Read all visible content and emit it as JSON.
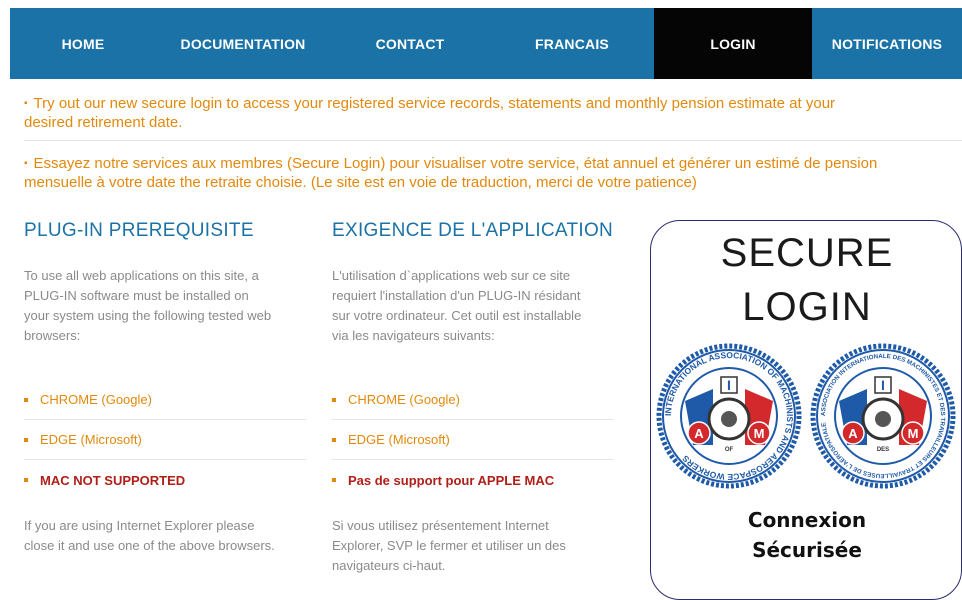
{
  "nav": {
    "items": [
      {
        "label": "HOME",
        "active": false
      },
      {
        "label": "DOCUMENTATION",
        "active": false
      },
      {
        "label": "CONTACT",
        "active": false
      },
      {
        "label": "FRANCAIS",
        "active": false
      },
      {
        "label": "LOGIN",
        "active": true
      },
      {
        "label": "NOTIFICATIONS",
        "active": false
      }
    ]
  },
  "notices": {
    "english_line1": "Try out our new secure login to access your registered service records, statements and monthly pension estimate at your",
    "english_line2": "desired retirement date.",
    "french_line1": "Essayez notre services aux membres (Secure Login) pour visualiser votre service, état annuel et générer un estimé de pension",
    "french_line2": "mensuelle à votre date the retraite choisie.  (Le site est en voie de traduction, merci de votre patience)"
  },
  "english_col": {
    "heading": "PLUG-IN PREREQUISITE",
    "intro_lines": [
      "To use all  web applications on this site, a",
      "PLUG-IN software must be installed on",
      "your system using the following tested web",
      "browsers:"
    ],
    "browsers": [
      "CHROME (Google)",
      "EDGE (Microsoft)",
      "MAC NOT SUPPORTED"
    ],
    "outro_lines": [
      "If you are using Internet Explorer please",
      "close it and use one of the above browsers."
    ]
  },
  "french_col": {
    "heading": "EXIGENCE DE L'APPLICATION",
    "intro_lines": [
      "L'utilisation d`applications web sur ce site",
      "requiert l'installation d'un PLUG-IN résidant",
      "sur votre ordinateur. Cet outil est installable",
      "via les navigateurs suivants:"
    ],
    "browsers": [
      "CHROME (Google)",
      "EDGE (Microsoft)",
      "Pas de support pour APPLE MAC"
    ],
    "outro_lines": [
      "Si vous utilisez présentement Internet",
      "Explorer, SVP le fermer et utiliser un des",
      "navigateurs ci-haut."
    ]
  },
  "login_box": {
    "title_line1": "SECURE",
    "title_line2": "LOGIN",
    "seal_left": {
      "ring_text": "INTERNATIONAL ASSOCIATION OF MACHINISTS AND AEROSPACE WORKERS",
      "letters": [
        "A",
        "I",
        "M"
      ],
      "of": "OF"
    },
    "seal_right": {
      "ring_text": "ASSOCIATION INTERNATIONALE DES MACHINISTES ET DES TRAVAILLEURS ET TRAVAILLEUSES DE L'AÉROSPATIALE",
      "letters": [
        "A",
        "I",
        "M"
      ],
      "of": "DES"
    },
    "connexion_line1": "Connexion",
    "connexion_line2": "Sécurisée"
  },
  "colors": {
    "nav_bg": "#1b72a6",
    "nav_active": "#050505",
    "accent_orange": "#e2890d",
    "heading_blue": "#1b72a6",
    "warning_red": "#b01e17",
    "seal_blue": "#1f5aa8",
    "seal_red": "#d3282c"
  }
}
